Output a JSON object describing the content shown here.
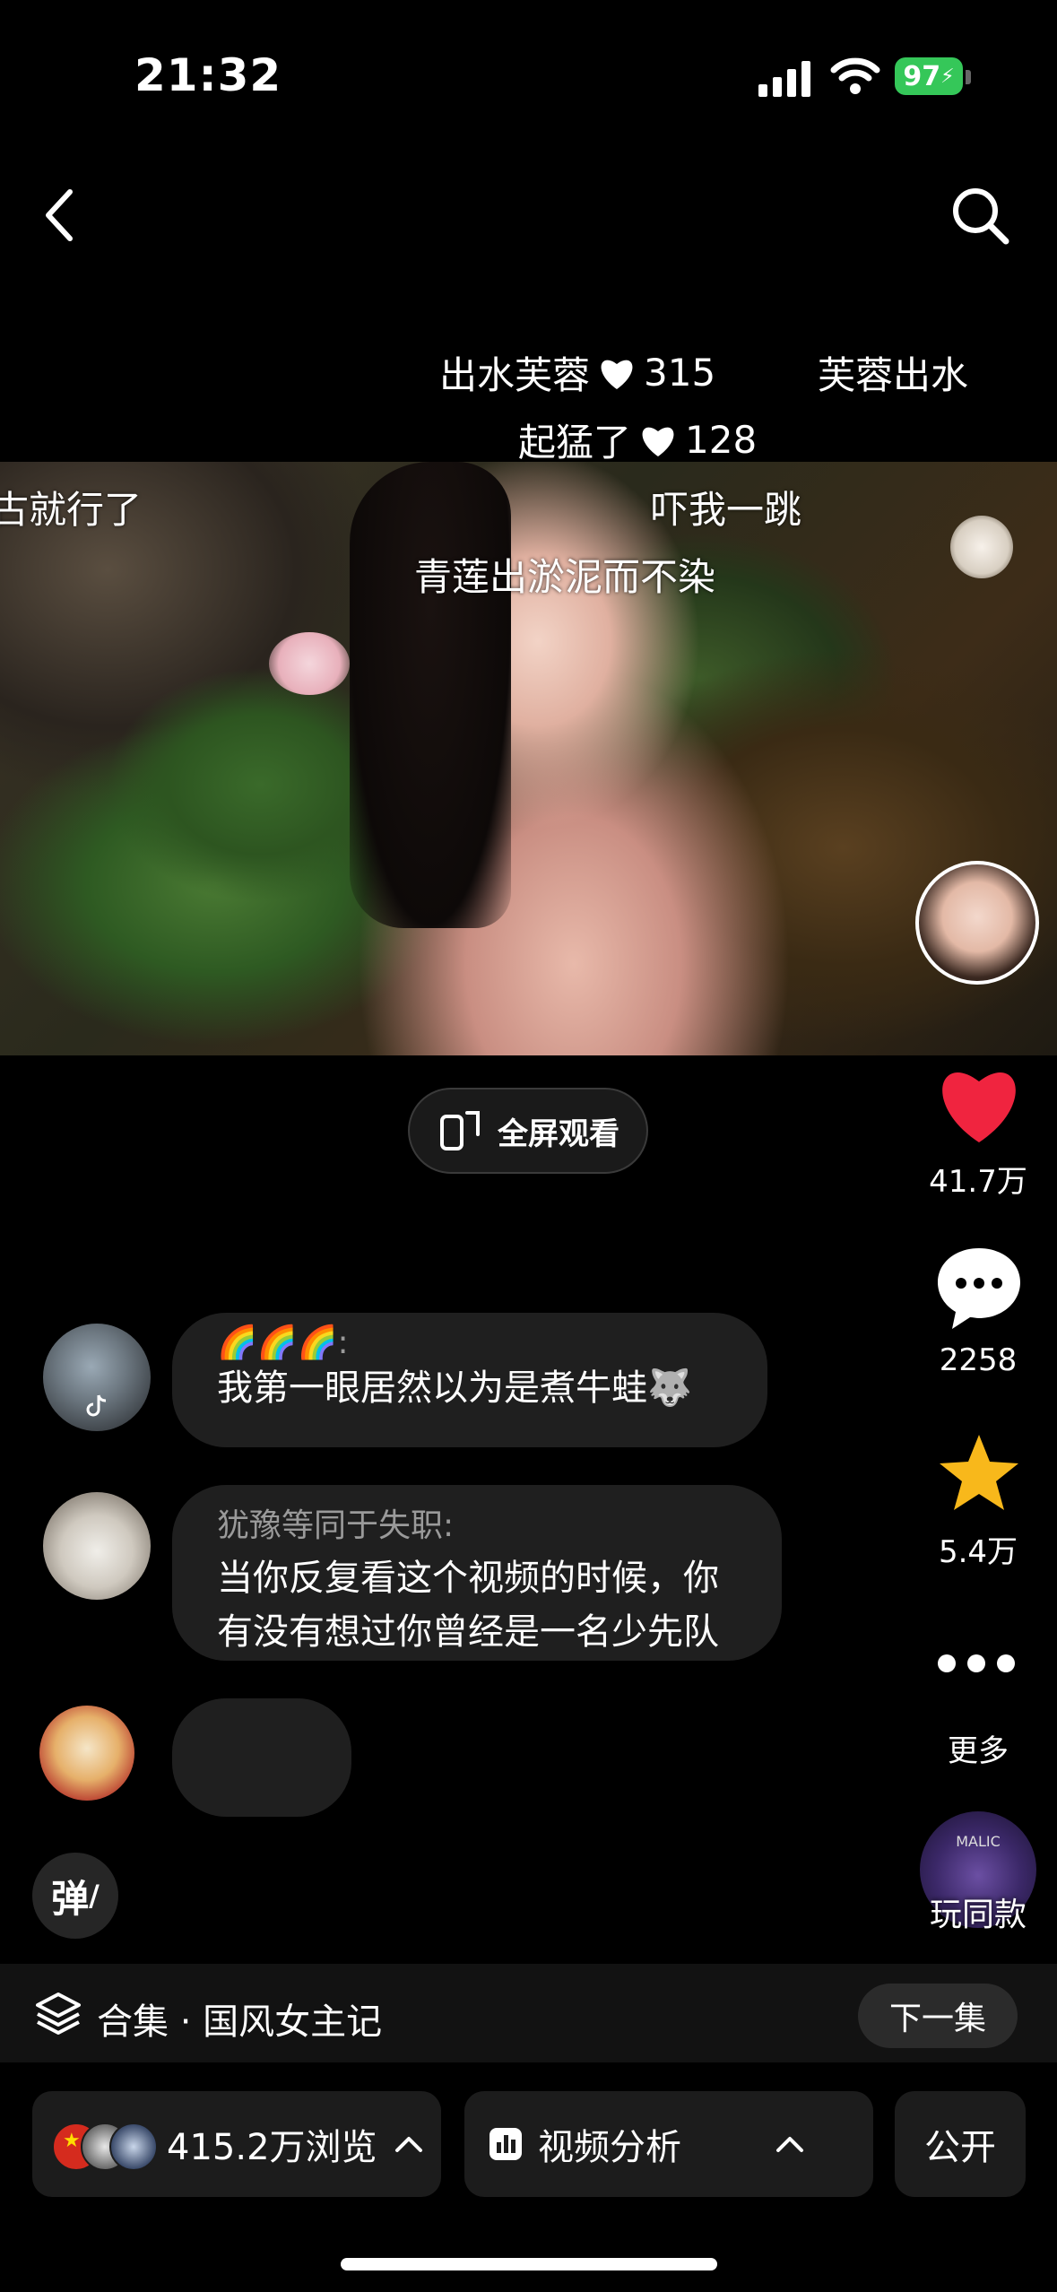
{
  "status_bar": {
    "time": "21:32",
    "battery": "97"
  },
  "danmaku": [
    {
      "text": "出水芙蓉",
      "likes": "315"
    },
    {
      "text": "芙蓉出水"
    },
    {
      "text": "起猛了",
      "likes": "128"
    },
    {
      "text": "古就行了"
    },
    {
      "text": "吓我一跳"
    },
    {
      "text": "青莲出淤泥而不染"
    }
  ],
  "fullscreen_label": "全屏观看",
  "rail": {
    "likes": "41.7万",
    "comments": "2258",
    "favorites": "5.4万",
    "more": "更多",
    "template": "玩同款",
    "template_badge": "MALIC"
  },
  "comments": [
    {
      "name": "🌈🌈🌈:",
      "text": "我第一眼居然以为是煮牛蛙🐺"
    },
    {
      "name": "犹豫等同于失职:",
      "text_line1": "当你反复看这个视频的时候，你",
      "text_line2": "有没有想过你曾经是一名少先队"
    }
  ],
  "danmaku_toggle": "弹",
  "collection": {
    "label": "合集 · 国风女主记",
    "next": "下一集"
  },
  "bottom": {
    "views": "415.2万浏览",
    "analysis": "视频分析",
    "visibility": "公开"
  },
  "colors": {
    "accent_red": "#f0243f",
    "star": "#f8b81b",
    "battery": "#35c759"
  }
}
